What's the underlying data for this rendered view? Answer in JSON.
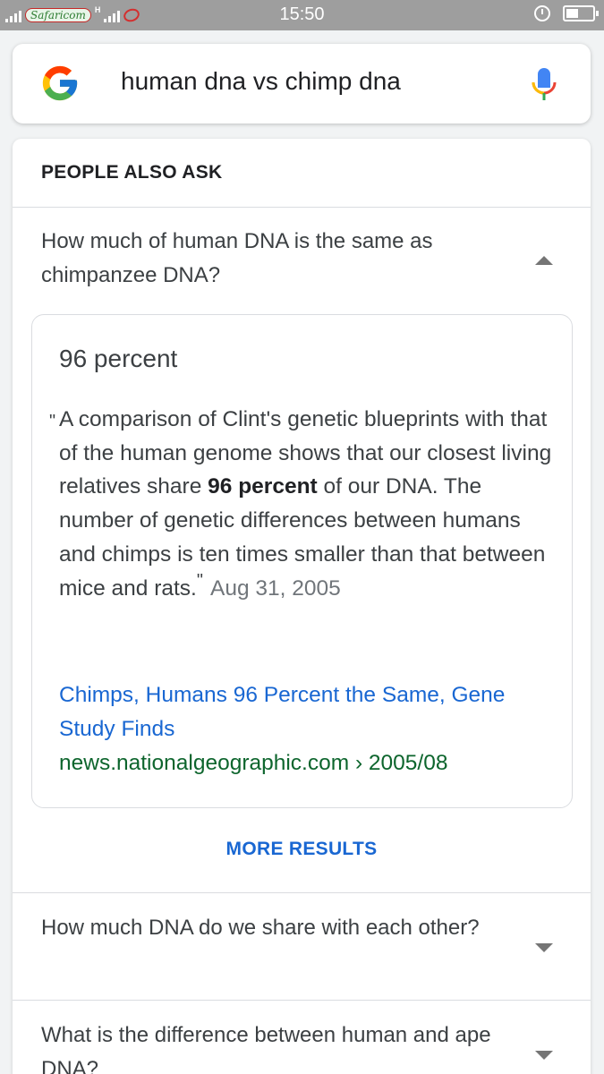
{
  "status_bar": {
    "carrier": "Safaricom",
    "network_type": "H",
    "time": "15:50",
    "battery_level": 0.45
  },
  "search": {
    "query": "human dna vs chimp dna",
    "logo_icon": "google-g-icon",
    "voice_icon": "microphone-icon"
  },
  "paa": {
    "heading": "PEOPLE ALSO ASK",
    "expanded": {
      "question": "How much of human DNA is the same as chimpanzee DNA?",
      "answer_title": "96 percent",
      "snippet_before": "A comparison of Clint's genetic blueprints with that of the human genome shows that our closest living relatives share ",
      "snippet_bold": "96 percent",
      "snippet_after": " of our DNA. The number of genetic differences between humans and chimps is ten times smaller than that between mice and rats.",
      "date": "Aug 31, 2005",
      "result_title": "Chimps, Humans 96 Percent the Same, Gene Study Finds",
      "result_url": "news.nationalgeographic.com › 2005/08"
    },
    "more_results_label": "MORE RESULTS",
    "questions": [
      {
        "text": "How much DNA do we share with each other?"
      },
      {
        "text": "What is the difference between human and ape DNA?"
      }
    ]
  },
  "colors": {
    "link": "#1967d2",
    "url_green": "#0d652d",
    "status_bar": "#9e9e9e"
  }
}
